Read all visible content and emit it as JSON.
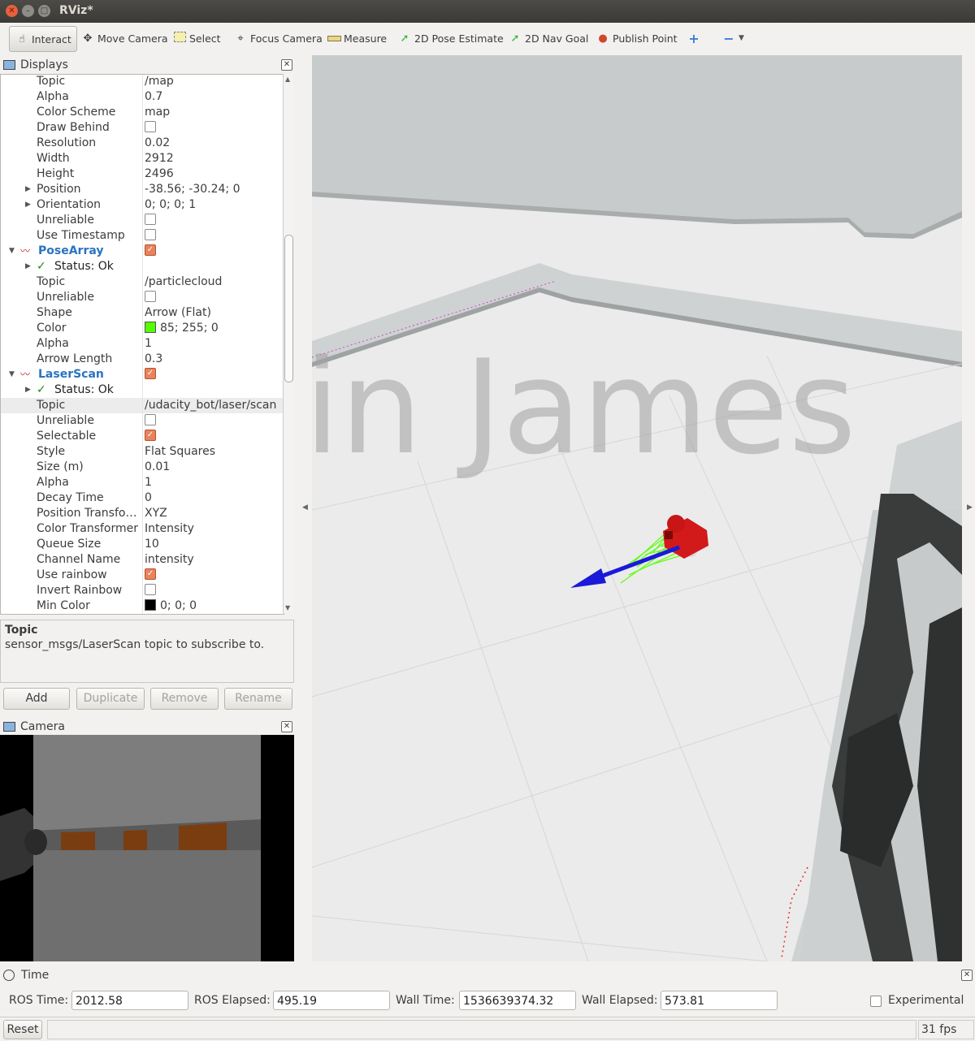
{
  "window": {
    "title": "RViz*"
  },
  "toolbar": {
    "interact": "Interact",
    "move_camera": "Move Camera",
    "select": "Select",
    "focus_camera": "Focus Camera",
    "measure": "Measure",
    "pose_estimate": "2D Pose Estimate",
    "nav_goal": "2D Nav Goal",
    "publish_point": "Publish Point"
  },
  "displays": {
    "title": "Displays",
    "rows": [
      {
        "name": "Topic",
        "value": "/map"
      },
      {
        "name": "Alpha",
        "value": "0.7"
      },
      {
        "name": "Color Scheme",
        "value": "map"
      },
      {
        "name": "Draw Behind",
        "checkbox": false
      },
      {
        "name": "Resolution",
        "value": "0.02"
      },
      {
        "name": "Width",
        "value": "2912"
      },
      {
        "name": "Height",
        "value": "2496"
      },
      {
        "name": "Position",
        "value": "-38.56; -30.24; 0",
        "expandable": true
      },
      {
        "name": "Orientation",
        "value": "0; 0; 0; 1",
        "expandable": true
      },
      {
        "name": "Unreliable",
        "checkbox": false
      },
      {
        "name": "Use Timestamp",
        "checkbox": false
      },
      {
        "name": "PoseArray",
        "group": true,
        "checkbox": true
      },
      {
        "name": "Status: Ok",
        "status": true
      },
      {
        "name": "Topic",
        "value": "/particlecloud"
      },
      {
        "name": "Unreliable",
        "checkbox": false
      },
      {
        "name": "Shape",
        "value": "Arrow (Flat)"
      },
      {
        "name": "Color",
        "value": "85; 255; 0",
        "swatch": "#55ff00"
      },
      {
        "name": "Alpha",
        "value": "1"
      },
      {
        "name": "Arrow Length",
        "value": "0.3"
      },
      {
        "name": "LaserScan",
        "group": true,
        "checkbox": true
      },
      {
        "name": "Status: Ok",
        "status": true
      },
      {
        "name": "Topic",
        "value": "/udacity_bot/laser/scan",
        "selected": true
      },
      {
        "name": "Unreliable",
        "checkbox": false
      },
      {
        "name": "Selectable",
        "checkbox": true
      },
      {
        "name": "Style",
        "value": "Flat Squares"
      },
      {
        "name": "Size (m)",
        "value": "0.01"
      },
      {
        "name": "Alpha",
        "value": "1"
      },
      {
        "name": "Decay Time",
        "value": "0"
      },
      {
        "name": "Position Transfo…",
        "value": "XYZ"
      },
      {
        "name": "Color Transformer",
        "value": "Intensity"
      },
      {
        "name": "Queue Size",
        "value": "10"
      },
      {
        "name": "Channel Name",
        "value": "intensity"
      },
      {
        "name": "Use rainbow",
        "checkbox": true
      },
      {
        "name": "Invert Rainbow",
        "checkbox": false
      },
      {
        "name": "Min Color",
        "value": "0; 0; 0",
        "swatch": "#000000"
      }
    ]
  },
  "description": {
    "title": "Topic",
    "text": "sensor_msgs/LaserScan topic to subscribe to."
  },
  "buttons": {
    "add": "Add",
    "duplicate": "Duplicate",
    "remove": "Remove",
    "rename": "Rename"
  },
  "camera": {
    "title": "Camera"
  },
  "watermark": "Kevin James",
  "time": {
    "title": "Time",
    "ros_time_label": "ROS Time:",
    "ros_time": "2012.58",
    "ros_elapsed_label": "ROS Elapsed:",
    "ros_elapsed": "495.19",
    "wall_time_label": "Wall Time:",
    "wall_time": "1536639374.32",
    "wall_elapsed_label": "Wall Elapsed:",
    "wall_elapsed": "573.81",
    "experimental": "Experimental"
  },
  "status": {
    "reset": "Reset",
    "fps": "31 fps"
  },
  "colors": {
    "accent_blue": "#2a73c0",
    "checkbox_on": "#e9835c",
    "robot_red": "#d21a1a",
    "arrow_blue": "#1a1ad8",
    "particles": "#55ff00"
  }
}
